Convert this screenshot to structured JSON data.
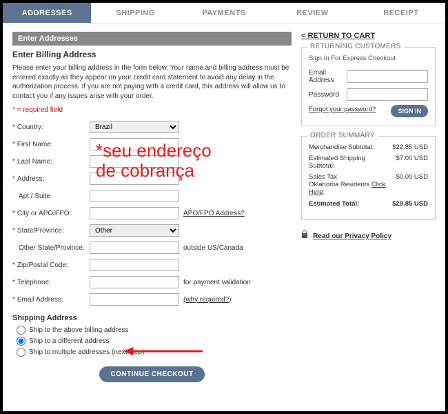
{
  "tabs": {
    "addresses": "ADDRESSES",
    "shipping": "SHIPPING",
    "payments": "PAYMENTS",
    "review": "REVIEW",
    "receipt": "RECEIPT"
  },
  "left": {
    "section_bar": "Enter Addresses",
    "billing_title": "Enter Billing Address",
    "instructions": "Please enter your billing address in the form below. Your name and billing address must be entered exactly as they appear on your credit card statement to avoid any delay in the authorization process. If you are not paying with a credit card, this address will allow us to contact you if any issues arise with your order.",
    "required_note": "* = required field",
    "fields": {
      "country": {
        "label": "Country:",
        "value": "Brazil"
      },
      "first_name": {
        "label": "First Name:",
        "value": ""
      },
      "last_name": {
        "label": "Last Name:",
        "value": ""
      },
      "address": {
        "label": "Address:",
        "value": ""
      },
      "apt": {
        "label": "Apt / Suite",
        "value": ""
      },
      "city": {
        "label": "City or APO/FPO:",
        "value": "",
        "hint": "APO/FPO Address?"
      },
      "state": {
        "label": "State/Province:",
        "value": "Other"
      },
      "other_state": {
        "label": "Other State/Province:",
        "value": "",
        "hint": "outside US/Canada"
      },
      "zip": {
        "label": "Zip/Postal Code:",
        "value": ""
      },
      "phone": {
        "label": "Telephone:",
        "value": "",
        "hint": "for payment validation"
      },
      "email": {
        "label": "Email Address:",
        "value": "",
        "hint": "(why required?)"
      }
    },
    "shipping_title": "Shipping Address",
    "ship_options": {
      "same": "Ship to the above billing address",
      "diff": "Ship to a different address",
      "multi": "Ship to multiple addresses (next step)"
    },
    "continue": "CONTINUE CHECKOUT"
  },
  "right": {
    "return": "< RETURN TO CART",
    "returning_title": "RETURNING CUSTOMERS",
    "signin_sub": "Sign In For Express Checkout",
    "email_label": "Email Address",
    "password_label": "Password",
    "forgot": "Forgot your password?",
    "signin_btn": "SIGN IN",
    "summary_title": "ORDER SUMMARY",
    "summary": {
      "merch_label": "Merchandise Subtotal:",
      "merch_val": "$22.85 USD",
      "ship_label": "Estimated Shipping Subtotal:",
      "ship_val": "$7.00 USD",
      "tax_label_a": "Sales Tax",
      "tax_label_b": "Oklahoma Residents ",
      "tax_link": "Click Here",
      "tax_val": "$0.00 USD",
      "total_label": "Estimated Total:",
      "total_val": "$29.85 USD"
    },
    "privacy": "Read our Privacy Policy"
  },
  "annotation": {
    "line1": "*seu endereço",
    "line2": "de cobrança"
  }
}
